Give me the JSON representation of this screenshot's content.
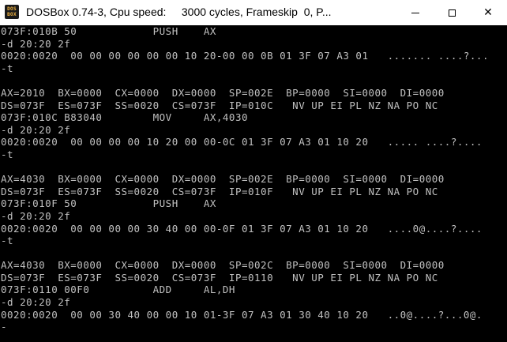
{
  "window": {
    "title": "DOSBox 0.74-3, Cpu speed:     3000 cycles, Frameskip  0, P...",
    "icon_text": [
      "DOS",
      "BOX"
    ],
    "icon_name": "dosbox-icon",
    "controls": {
      "minimize": "minimize-icon",
      "maximize": "maximize-icon",
      "close": "close-icon",
      "close_glyph": "✕"
    }
  },
  "colors": {
    "console_bg": "#000000",
    "console_fg": "#c0c0c0",
    "titlebar_bg": "#ffffff"
  },
  "console": {
    "lines": [
      "073F:010B 50            PUSH    AX",
      "-d 20:20 2f",
      "0020:0020  00 00 00 00 00 00 10 20-00 00 0B 01 3F 07 A3 01   ....... ....?...",
      "-t",
      "",
      "AX=2010  BX=0000  CX=0000  DX=0000  SP=002E  BP=0000  SI=0000  DI=0000",
      "DS=073F  ES=073F  SS=0020  CS=073F  IP=010C   NV UP EI PL NZ NA PO NC",
      "073F:010C B83040        MOV     AX,4030",
      "-d 20:20 2f",
      "0020:0020  00 00 00 00 10 20 00 00-0C 01 3F 07 A3 01 10 20   ..... ....?....",
      "-t",
      "",
      "AX=4030  BX=0000  CX=0000  DX=0000  SP=002E  BP=0000  SI=0000  DI=0000",
      "DS=073F  ES=073F  SS=0020  CS=073F  IP=010F   NV UP EI PL NZ NA PO NC",
      "073F:010F 50            PUSH    AX",
      "-d 20:20 2f",
      "0020:0020  00 00 00 00 30 40 00 00-0F 01 3F 07 A3 01 10 20   ....0@....?....",
      "-t",
      "",
      "AX=4030  BX=0000  CX=0000  DX=0000  SP=002C  BP=0000  SI=0000  DI=0000",
      "DS=073F  ES=073F  SS=0020  CS=073F  IP=0110   NV UP EI PL NZ NA PO NC",
      "073F:0110 00F0          ADD     AL,DH",
      "-d 20:20 2f",
      "0020:0020  00 00 30 40 00 00 10 01-3F 07 A3 01 30 40 10 20   ..0@....?...0@.",
      "-"
    ]
  }
}
